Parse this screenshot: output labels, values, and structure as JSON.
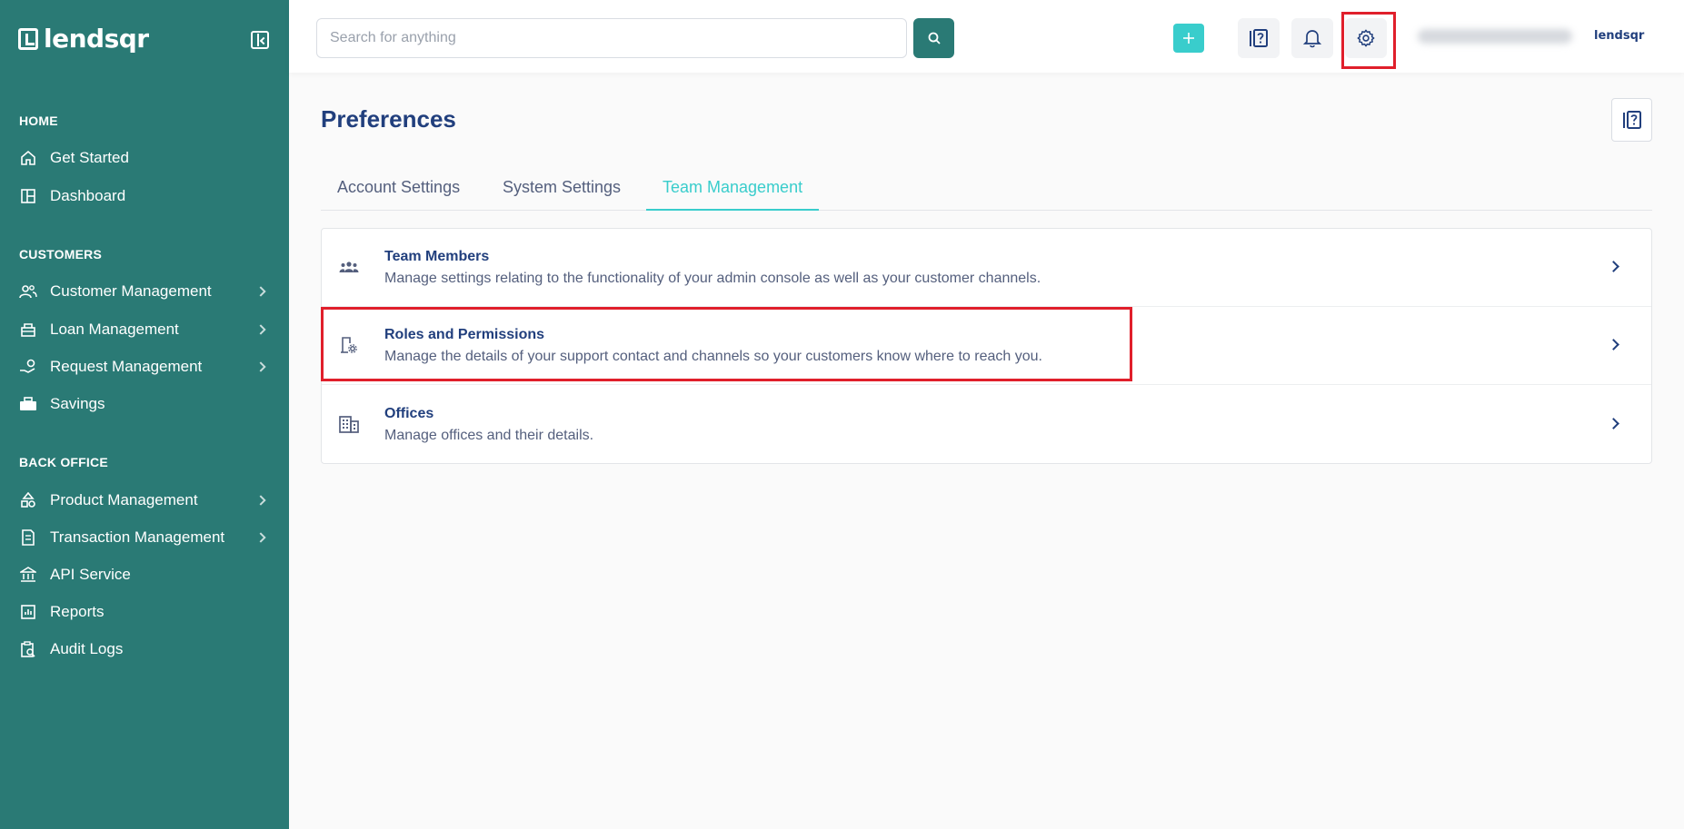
{
  "brand": {
    "name": "lendsqr",
    "small_logo": "lendsqr"
  },
  "sidebar": {
    "sections": [
      {
        "title": "HOME"
      },
      {
        "title": "CUSTOMERS"
      },
      {
        "title": "BACK OFFICE"
      }
    ],
    "items": [
      {
        "label": "Get Started",
        "icon": "home-icon"
      },
      {
        "label": "Dashboard",
        "icon": "dashboard-icon"
      },
      {
        "label": "Customer Management",
        "icon": "users-icon"
      },
      {
        "label": "Loan Management",
        "icon": "loan-icon"
      },
      {
        "label": "Request Management",
        "icon": "request-icon"
      },
      {
        "label": "Savings",
        "icon": "savings-icon"
      },
      {
        "label": "Product Management",
        "icon": "product-icon"
      },
      {
        "label": "Transaction Management",
        "icon": "transaction-icon"
      },
      {
        "label": "API Service",
        "icon": "bank-icon"
      },
      {
        "label": "Reports",
        "icon": "reports-icon"
      },
      {
        "label": "Audit Logs",
        "icon": "audit-icon"
      }
    ]
  },
  "header": {
    "search_placeholder": "Search for anything"
  },
  "page": {
    "title": "Preferences",
    "tabs": [
      {
        "label": "Account Settings"
      },
      {
        "label": "System Settings"
      },
      {
        "label": "Team Management"
      }
    ],
    "active_tab": "Team Management",
    "rows": [
      {
        "title": "Team Members",
        "desc": "Manage settings relating to the functionality of your admin console as well as your customer channels.",
        "icon": "team-icon"
      },
      {
        "title": "Roles and Permissions",
        "desc": "Manage the details of your support contact and channels so your customers know where to reach you.",
        "icon": "roles-icon"
      },
      {
        "title": "Offices",
        "desc": "Manage offices and their details.",
        "icon": "office-icon"
      }
    ]
  },
  "colors": {
    "sidebar_bg": "#2a7a75",
    "accent": "#39cdcc",
    "primary_text": "#213f7d",
    "highlight": "#e01f2b"
  }
}
